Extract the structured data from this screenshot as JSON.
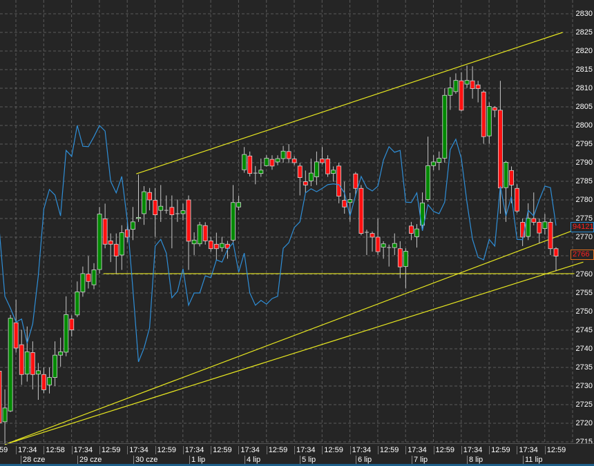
{
  "chart_data": {
    "type": "candlestick",
    "title": "",
    "xlabel": "",
    "ylabel": "",
    "ylim": [
      2715,
      2830
    ],
    "y_ticks": [
      2830,
      2825,
      2820,
      2815,
      2810,
      2805,
      2800,
      2795,
      2790,
      2785,
      2780,
      2775,
      2770,
      2765,
      2760,
      2755,
      2750,
      2745,
      2740,
      2735,
      2730,
      2725,
      2720,
      2715
    ],
    "grid": true,
    "time_labels": [
      "59",
      "17:34",
      "12:58",
      "17:34",
      "12:59",
      "17:34",
      "12:59",
      "17:34",
      "12:59",
      "17:34",
      "12:59",
      "17:34",
      "12:59",
      "17:34",
      "12:59",
      "17:34",
      "12:59",
      "17:34",
      "12:59",
      "17:34",
      "12:59"
    ],
    "date_labels": [
      "28 cze",
      "29 cze",
      "30 cze",
      "1 lip",
      "4 lip",
      "5 lip",
      "6 lip",
      "7 lip",
      "8 lip",
      "11 lip"
    ],
    "candles_ohlc": [
      [
        2734,
        2737,
        2718,
        2720.1
      ],
      [
        2720.4,
        2729.1,
        2714.3,
        2724.1
      ],
      [
        2723.3,
        2749.1,
        2723,
        2748.2
      ],
      [
        2747,
        2753.2,
        2739,
        2740.2
      ],
      [
        2741.1,
        2745.1,
        2730.3,
        2733.1
      ],
      [
        2733.2,
        2746,
        2731.2,
        2739.2
      ],
      [
        2739,
        2742,
        2729.1,
        2733.1
      ],
      [
        2733.2,
        2736.2,
        2726.3,
        2734.1
      ],
      [
        2733.1,
        2735,
        2728.1,
        2729
      ],
      [
        2730.3,
        2735,
        2728,
        2732.3
      ],
      [
        2732.3,
        2742,
        2730,
        2738.3
      ],
      [
        2738.3,
        2743,
        2735.2,
        2739.2
      ],
      [
        2739.1,
        2754.1,
        2738,
        2749.2
      ],
      [
        2748,
        2749,
        2743.3,
        2745.1
      ],
      [
        2749.1,
        2758.1,
        2748.5,
        2755.3
      ],
      [
        2755.3,
        2762.1,
        2754,
        2760.2
      ],
      [
        2760.1,
        2764.9,
        2756.2,
        2758.1
      ],
      [
        2757.2,
        2763,
        2756,
        2761.2
      ],
      [
        2761.3,
        2778.1,
        2760.2,
        2776.2
      ],
      [
        2774.9,
        2779,
        2767,
        2768.1
      ],
      [
        2769,
        2771,
        2763.3,
        2768.1
      ],
      [
        2768.1,
        2771,
        2760.2,
        2764.9
      ],
      [
        2765.2,
        2773.2,
        2761.2,
        2771.2
      ],
      [
        2772,
        2774.1,
        2768.6,
        2770
      ],
      [
        2772.1,
        2778.1,
        2769.2,
        2774.1
      ],
      [
        2775,
        2786.8,
        2774.1,
        2775.3
      ],
      [
        2776.3,
        2783.7,
        2773.3,
        2782.2
      ],
      [
        2782,
        2783.2,
        2777.2,
        2780
      ],
      [
        2779.9,
        2783.2,
        2770.1,
        2776
      ],
      [
        2777.2,
        2784,
        2774.1,
        2778.3
      ],
      [
        2777.2,
        2781.2,
        2776.3,
        2777.2
      ],
      [
        2778,
        2781.2,
        2767,
        2776
      ],
      [
        2776.3,
        2780.1,
        2774.1,
        2776.3
      ],
      [
        2776.3,
        2779,
        2774.5,
        2777.1
      ],
      [
        2780,
        2781.2,
        2761.2,
        2768.9
      ],
      [
        2768.2,
        2771.3,
        2765.2,
        2769.2
      ],
      [
        2768.2,
        2774.1,
        2767.5,
        2773.3
      ],
      [
        2773.1,
        2774,
        2768,
        2769
      ],
      [
        2769,
        2770.1,
        2766.1,
        2766.9
      ],
      [
        2768.1,
        2771.2,
        2763.9,
        2766.9
      ],
      [
        2767.2,
        2770.1,
        2766.1,
        2768.3
      ],
      [
        2768.1,
        2769,
        2764.2,
        2767
      ],
      [
        2769.2,
        2784,
        2768,
        2779.3
      ],
      [
        2778.1,
        2781.1,
        2777.2,
        2779.3
      ],
      [
        2788.1,
        2794.2,
        2787.3,
        2792.2
      ],
      [
        2791.8,
        2793,
        2786.3,
        2787.1
      ],
      [
        2787.2,
        2789.1,
        2784.2,
        2787.2
      ],
      [
        2787.1,
        2791.1,
        2786.2,
        2788
      ],
      [
        2789.2,
        2792,
        2789,
        2791.2
      ],
      [
        2790.9,
        2792,
        2788.1,
        2789.1
      ],
      [
        2790.2,
        2792,
        2789.3,
        2791.1
      ],
      [
        2791.1,
        2794.5,
        2790,
        2793.1
      ],
      [
        2793,
        2795,
        2789.9,
        2791.1
      ],
      [
        2791,
        2791.7,
        2789.3,
        2790
      ],
      [
        2789.1,
        2789.9,
        2781.2,
        2786
      ],
      [
        2784.9,
        2787.9,
        2781.9,
        2784
      ],
      [
        2785.1,
        2791.1,
        2783.7,
        2787.2
      ],
      [
        2786.2,
        2793,
        2784,
        2790.2
      ],
      [
        2791,
        2794.2,
        2789.5,
        2790
      ],
      [
        2791,
        2792,
        2786.2,
        2787
      ],
      [
        2787.1,
        2789,
        2784.9,
        2788
      ],
      [
        2789.1,
        2790,
        2779.1,
        2781
      ],
      [
        2779.9,
        2784.9,
        2776.3,
        2778.1
      ],
      [
        2779.3,
        2781.9,
        2774.1,
        2780.1
      ],
      [
        2787,
        2787.5,
        2781.2,
        2783.1
      ],
      [
        2783.1,
        2784,
        2770.5,
        2771
      ],
      [
        2771.3,
        2772,
        2765.2,
        2771.3
      ],
      [
        2771,
        2771.5,
        2766.1,
        2770
      ],
      [
        2770,
        2775,
        2765.2,
        2766.1
      ],
      [
        2767.3,
        2768.9,
        2764.2,
        2768.2
      ],
      [
        2767.2,
        2768,
        2762.1,
        2767.2
      ],
      [
        2767.2,
        2771,
        2765.2,
        2768.3
      ],
      [
        2766.9,
        2768.9,
        2759,
        2762
      ],
      [
        2762.1,
        2767,
        2756.2,
        2766.2
      ],
      [
        2773,
        2774.1,
        2769.2,
        2771
      ],
      [
        2770.1,
        2773.5,
        2767.2,
        2772.2
      ],
      [
        2773.2,
        2782,
        2772,
        2779.2
      ],
      [
        2780.1,
        2797,
        2779.5,
        2789.2
      ],
      [
        2789.2,
        2792,
        2788,
        2790.2
      ],
      [
        2790.1,
        2793,
        2788,
        2791.2
      ],
      [
        2791.2,
        2810,
        2790,
        2808.1
      ],
      [
        2808.1,
        2813,
        2804.2,
        2810.1
      ],
      [
        2809.1,
        2814,
        2808.5,
        2812.1
      ],
      [
        2812,
        2814.3,
        2803.8,
        2804.1
      ],
      [
        2811.1,
        2816.1,
        2810.1,
        2812.1
      ],
      [
        2812,
        2815.9,
        2807.2,
        2809.9
      ],
      [
        2810.9,
        2812,
        2806.2,
        2809.9
      ],
      [
        2809,
        2809.5,
        2795.1,
        2797
      ],
      [
        2797.2,
        2806.2,
        2795.1,
        2805.1
      ],
      [
        2804.8,
        2805.2,
        2802.2,
        2804.1
      ],
      [
        2804.1,
        2812,
        2776.3,
        2783.2
      ],
      [
        2783.3,
        2790.5,
        2774.1,
        2790.1
      ],
      [
        2787.9,
        2789,
        2779.1,
        2784
      ],
      [
        2783.1,
        2784.2,
        2776.5,
        2777
      ],
      [
        2774,
        2775,
        2767.6,
        2770
      ],
      [
        2770.2,
        2779.1,
        2769.2,
        2775.1
      ],
      [
        2775,
        2782,
        2773.2,
        2774
      ],
      [
        2774,
        2775,
        2768.3,
        2771.1
      ],
      [
        2772.3,
        2776.2,
        2770.7,
        2774.1
      ],
      [
        2774,
        2775,
        2765.2,
        2766.9
      ],
      [
        2766.9,
        2767.3,
        2760.9,
        2764.9
      ]
    ],
    "indicator_line": [
      2772.0,
      2754.1,
      2750.9,
      2747.2,
      2748.0,
      2741.5,
      2746.7,
      2759.6,
      2777.6,
      2782.8,
      2781.3,
      2775.7,
      2793.3,
      2791.7,
      2800.0,
      2794.4,
      2794.3,
      2797.0,
      2800.0,
      2798.5,
      2785.0,
      2781.9,
      2786.3,
      2774.4,
      2755.9,
      2736.5,
      2740.2,
      2745.7,
      2767.6,
      2769.4,
      2765.7,
      2753.7,
      2755.4,
      2761.5,
      2751.7,
      2755.0,
      2755.0,
      2759.6,
      2759.1,
      2763.9,
      2763.3,
      2766.7,
      2768.5,
      2760.6,
      2765.7,
      2755.0,
      2751.7,
      2753.0,
      2752.0,
      2753.5,
      2754.1,
      2767.0,
      2768.5,
      2772.6,
      2774.1,
      2781.9,
      2783.0,
      2782.2,
      2783.1,
      2784.1,
      2784.3,
      2784.1,
      2781.9,
      2775.7,
      2781.3,
      2786.3,
      2783.3,
      2782.4,
      2783.7,
      2790.7,
      2794.3,
      2792.8,
      2793.3,
      2779.4,
      2779.3,
      2781.9,
      2771.7,
      2778.7,
      2776.9,
      2776.3,
      2779.4,
      2793.5,
      2796.3,
      2791.1,
      2779.4,
      2769.4,
      2764.6,
      2763.9,
      2769.4,
      2767.6,
      2783.7,
      2775.7,
      2780.9,
      2769.4,
      2769.3,
      2777.2,
      2775.7,
      2780.0,
      2783.7,
      2783.3,
      2773.1
    ],
    "trend_lines": [
      {
        "name": "upper-channel-line",
        "from": [
          24.6,
          2787.0
        ],
        "to": [
          101.2,
          2825.0
        ]
      },
      {
        "name": "support-horizontal-line",
        "from": [
          18.7,
          2760.2
        ],
        "to": [
          103.3,
          2760.2
        ]
      },
      {
        "name": "lower-trend-line-a",
        "from": [
          1.0,
          2714.3
        ],
        "to": [
          106.8,
          2773.9
        ]
      },
      {
        "name": "lower-trend-line-b",
        "from": [
          1.0,
          2714.3
        ],
        "to": [
          104.9,
          2763.3
        ]
      }
    ]
  },
  "price_boxes": {
    "last_value": "94121",
    "current_price": "2766"
  },
  "colors": {
    "background": "#252525",
    "grid": "#5a5a5a",
    "up": "#008a00",
    "down": "#ff1010",
    "wick": "#c8c8c8",
    "indicator": "#2f8fd8",
    "trend": "#e8e820"
  }
}
